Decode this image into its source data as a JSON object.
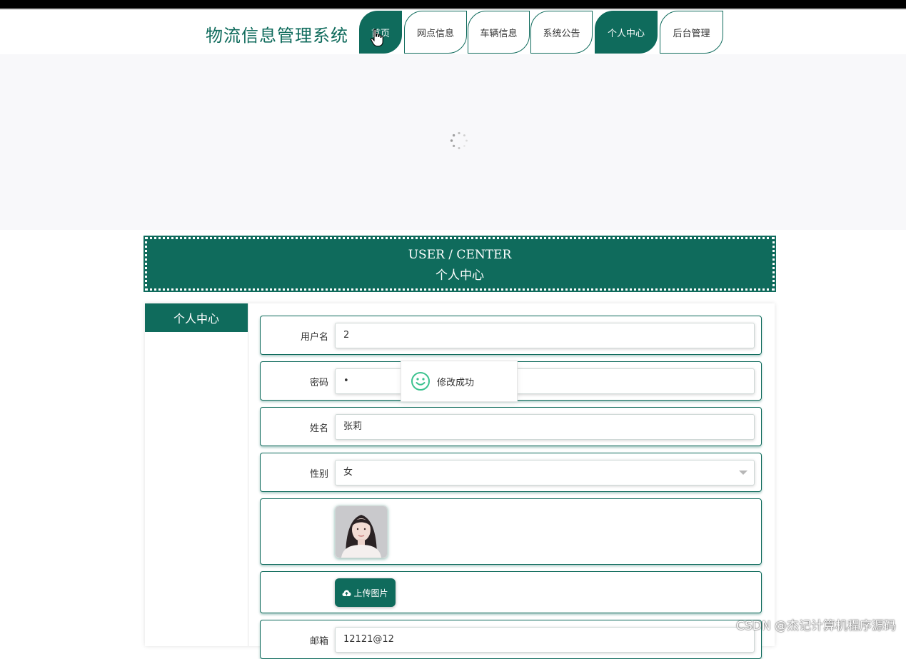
{
  "header": {
    "site_title": "物流信息管理系统",
    "nav": [
      {
        "label": "首页",
        "active": true
      },
      {
        "label": "网点信息",
        "active": false
      },
      {
        "label": "车辆信息",
        "active": false
      },
      {
        "label": "系统公告",
        "active": false
      },
      {
        "label": "个人中心",
        "active": true
      },
      {
        "label": "后台管理",
        "active": false
      }
    ]
  },
  "section": {
    "title_en": "USER / CENTER",
    "title_cn": "个人中心"
  },
  "sidebar": {
    "items": [
      {
        "label": "个人中心"
      }
    ]
  },
  "form": {
    "username_label": "用户名",
    "username_value": "2",
    "password_label": "密码",
    "password_value": "•",
    "name_label": "姓名",
    "name_value": "张莉",
    "gender_label": "性别",
    "gender_value": "女",
    "upload_label": "上传图片",
    "email_label": "邮箱",
    "email_value": "12121@12"
  },
  "toast": {
    "message": "修改成功",
    "icon": "smile-icon"
  },
  "watermark": "CSDN @杰记计算机程序源码",
  "colors": {
    "primary": "#0f6b5c",
    "banner_bg": "#f8f8fa",
    "success": "#3cc28f"
  }
}
